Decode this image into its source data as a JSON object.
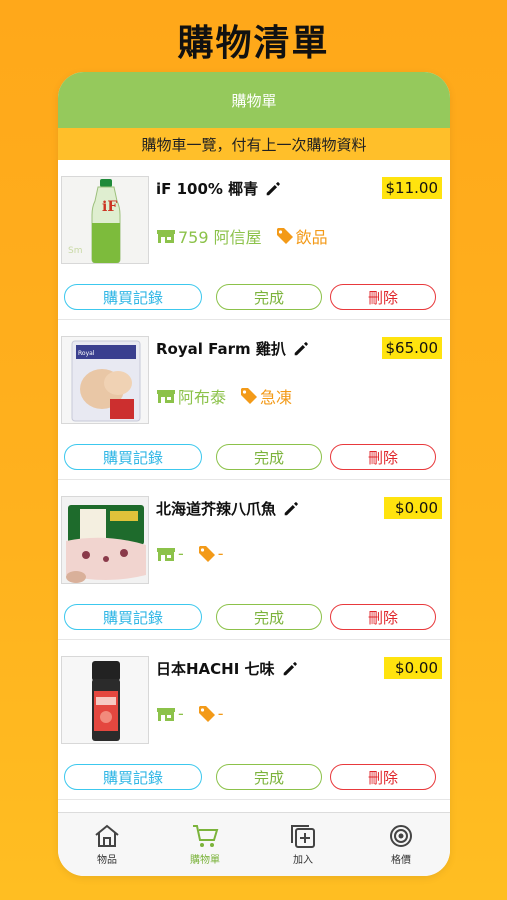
{
  "page_title": "購物清單",
  "nav": {
    "title": "購物單"
  },
  "subtitle": "購物車一覽，付有上一次購物資料",
  "accent_colors": {
    "green": "#95c95c",
    "orange": "#ffbf2a",
    "price_bg": "#ffe30e",
    "history": "#3cc8ee",
    "done": "#8cc24a",
    "delete": "#e8393c"
  },
  "items": [
    {
      "name": "iF 100% 椰青",
      "price": "$11.00",
      "store": "759 阿信屋",
      "tag": "飲品",
      "thumb_icon": "coconut-water-bottle-image",
      "history_label": "購買記錄",
      "done_label": "完成",
      "delete_label": "刪除"
    },
    {
      "name": "Royal Farm 雞扒",
      "price": "$65.00",
      "store": "阿布泰",
      "tag": "急凍",
      "thumb_icon": "chicken-pack-image",
      "history_label": "購買記錄",
      "done_label": "完成",
      "delete_label": "刪除"
    },
    {
      "name": "北海道芥辣八爪魚",
      "price": "$0.00",
      "store": "-",
      "tag": "-",
      "thumb_icon": "octopus-pack-image",
      "history_label": "購買記錄",
      "done_label": "完成",
      "delete_label": "刪除"
    },
    {
      "name": "日本HACHI 七味",
      "price": "$0.00",
      "store": "-",
      "tag": "-",
      "thumb_icon": "spice-bottle-image",
      "history_label": "購買記錄",
      "done_label": "完成",
      "delete_label": "刪除"
    }
  ],
  "tabs": [
    {
      "label": "物品",
      "icon": "home-icon",
      "active": false
    },
    {
      "label": "購物單",
      "icon": "cart-icon",
      "active": true
    },
    {
      "label": "加入",
      "icon": "add-icon",
      "active": false
    },
    {
      "label": "格價",
      "icon": "target-icon",
      "active": false
    }
  ]
}
